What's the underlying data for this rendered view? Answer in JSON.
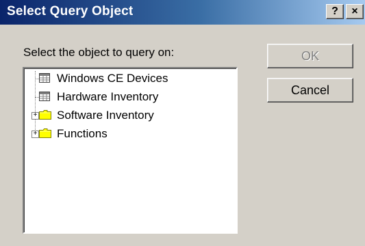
{
  "window": {
    "title": "Select Query Object",
    "help_label": "?",
    "close_label": "×"
  },
  "prompt": "Select the object to query on:",
  "tree": {
    "items": [
      {
        "label": "Windows CE Devices",
        "icon": "table-icon",
        "expandable": false
      },
      {
        "label": "Hardware Inventory",
        "icon": "table-icon",
        "expandable": false
      },
      {
        "label": "Software Inventory",
        "icon": "folder-icon",
        "expandable": true,
        "expander": "+"
      },
      {
        "label": "Functions",
        "icon": "folder-icon",
        "expandable": true,
        "expander": "+"
      }
    ]
  },
  "buttons": {
    "ok_label": "OK",
    "ok_enabled": false,
    "cancel_label": "Cancel"
  },
  "colors": {
    "title_gradient_start": "#0a246a",
    "title_gradient_end": "#a6caf0",
    "folder": "#ffff00",
    "dialog_bg": "#d4d0c8"
  }
}
